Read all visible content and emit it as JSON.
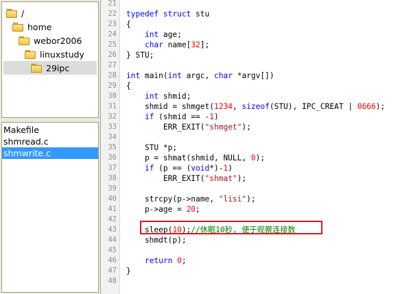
{
  "folder_tree": [
    {
      "label": "/",
      "indent": 0,
      "selected": false
    },
    {
      "label": "home",
      "indent": 1,
      "selected": false
    },
    {
      "label": "webor2006",
      "indent": 2,
      "selected": false
    },
    {
      "label": "linuxstudy",
      "indent": 3,
      "selected": false
    },
    {
      "label": "29ipc",
      "indent": 4,
      "selected": true
    }
  ],
  "files": [
    {
      "label": "Makefile",
      "selected": false
    },
    {
      "label": "shmread.c",
      "selected": false
    },
    {
      "label": "shmwrite.c",
      "selected": true
    }
  ],
  "editor": {
    "line_numbers": [
      "21",
      "22",
      "23",
      "24",
      "25",
      "26",
      "27",
      "28",
      "29",
      "30",
      "31",
      "32",
      "33",
      "34",
      "35",
      "36",
      "37",
      "38",
      "39",
      "40",
      "41",
      "42",
      "43",
      "44",
      "45",
      "46",
      "47",
      "48"
    ],
    "lines": [
      [],
      [
        {
          "t": "typedef struct",
          "c": "kw"
        },
        {
          "t": " stu",
          "c": ""
        }
      ],
      [
        {
          "t": "{",
          "c": ""
        }
      ],
      [
        {
          "t": "    ",
          "c": ""
        },
        {
          "t": "int",
          "c": "kw"
        },
        {
          "t": " age;",
          "c": ""
        }
      ],
      [
        {
          "t": "    ",
          "c": ""
        },
        {
          "t": "char",
          "c": "kw"
        },
        {
          "t": " name[",
          "c": ""
        },
        {
          "t": "32",
          "c": "num"
        },
        {
          "t": "];",
          "c": ""
        }
      ],
      [
        {
          "t": "} STU;",
          "c": ""
        }
      ],
      [],
      [
        {
          "t": "int",
          "c": "kw"
        },
        {
          "t": " main(",
          "c": ""
        },
        {
          "t": "int",
          "c": "kw"
        },
        {
          "t": " argc, ",
          "c": ""
        },
        {
          "t": "char",
          "c": "kw"
        },
        {
          "t": " *argv[])",
          "c": ""
        }
      ],
      [
        {
          "t": "{",
          "c": ""
        }
      ],
      [
        {
          "t": "    ",
          "c": ""
        },
        {
          "t": "int",
          "c": "kw"
        },
        {
          "t": " shmid;",
          "c": ""
        }
      ],
      [
        {
          "t": "    shmid = shmget(",
          "c": ""
        },
        {
          "t": "1234",
          "c": "num"
        },
        {
          "t": ", ",
          "c": ""
        },
        {
          "t": "sizeof",
          "c": "kw"
        },
        {
          "t": "(STU), IPC_CREAT | ",
          "c": ""
        },
        {
          "t": "0666",
          "c": "num"
        },
        {
          "t": ");",
          "c": ""
        }
      ],
      [
        {
          "t": "    ",
          "c": ""
        },
        {
          "t": "if",
          "c": "kw"
        },
        {
          "t": " (shmid == -",
          "c": ""
        },
        {
          "t": "1",
          "c": "num"
        },
        {
          "t": ")",
          "c": ""
        }
      ],
      [
        {
          "t": "        ERR_EXIT(",
          "c": ""
        },
        {
          "t": "\"shmget\"",
          "c": "str"
        },
        {
          "t": ");",
          "c": ""
        }
      ],
      [],
      [
        {
          "t": "    STU *p;",
          "c": ""
        }
      ],
      [
        {
          "t": "    p = shmat(shmid, NULL, ",
          "c": ""
        },
        {
          "t": "0",
          "c": "num"
        },
        {
          "t": ");",
          "c": ""
        }
      ],
      [
        {
          "t": "    ",
          "c": ""
        },
        {
          "t": "if",
          "c": "kw"
        },
        {
          "t": " (p == (",
          "c": ""
        },
        {
          "t": "void",
          "c": "kw"
        },
        {
          "t": "*)-",
          "c": ""
        },
        {
          "t": "1",
          "c": "num"
        },
        {
          "t": ")",
          "c": ""
        }
      ],
      [
        {
          "t": "        ERR_EXIT(",
          "c": ""
        },
        {
          "t": "\"shmat\"",
          "c": "str"
        },
        {
          "t": ");",
          "c": ""
        }
      ],
      [],
      [
        {
          "t": "    strcpy(p->name, ",
          "c": ""
        },
        {
          "t": "\"lisi\"",
          "c": "str"
        },
        {
          "t": ");",
          "c": ""
        }
      ],
      [
        {
          "t": "    p->age = ",
          "c": ""
        },
        {
          "t": "20",
          "c": "num"
        },
        {
          "t": ";",
          "c": ""
        }
      ],
      [],
      [
        {
          "t": "    sleep(",
          "c": ""
        },
        {
          "t": "10",
          "c": "num"
        },
        {
          "t": ");",
          "c": ""
        },
        {
          "t": "//休眠10秒, 便于观察连接数",
          "c": "com"
        }
      ],
      [
        {
          "t": "    shmdt(p);",
          "c": ""
        }
      ],
      [],
      [
        {
          "t": "    ",
          "c": ""
        },
        {
          "t": "return",
          "c": "kw"
        },
        {
          "t": " ",
          "c": ""
        },
        {
          "t": "0",
          "c": "num"
        },
        {
          "t": ";",
          "c": ""
        }
      ],
      [
        {
          "t": "}",
          "c": ""
        }
      ],
      []
    ]
  },
  "colors": {
    "keyword": "#0000ff",
    "number": "#ff0000",
    "string": "#a31515",
    "comment": "#008000",
    "selection": "#3399ff",
    "highlight_border": "#e0141e"
  }
}
